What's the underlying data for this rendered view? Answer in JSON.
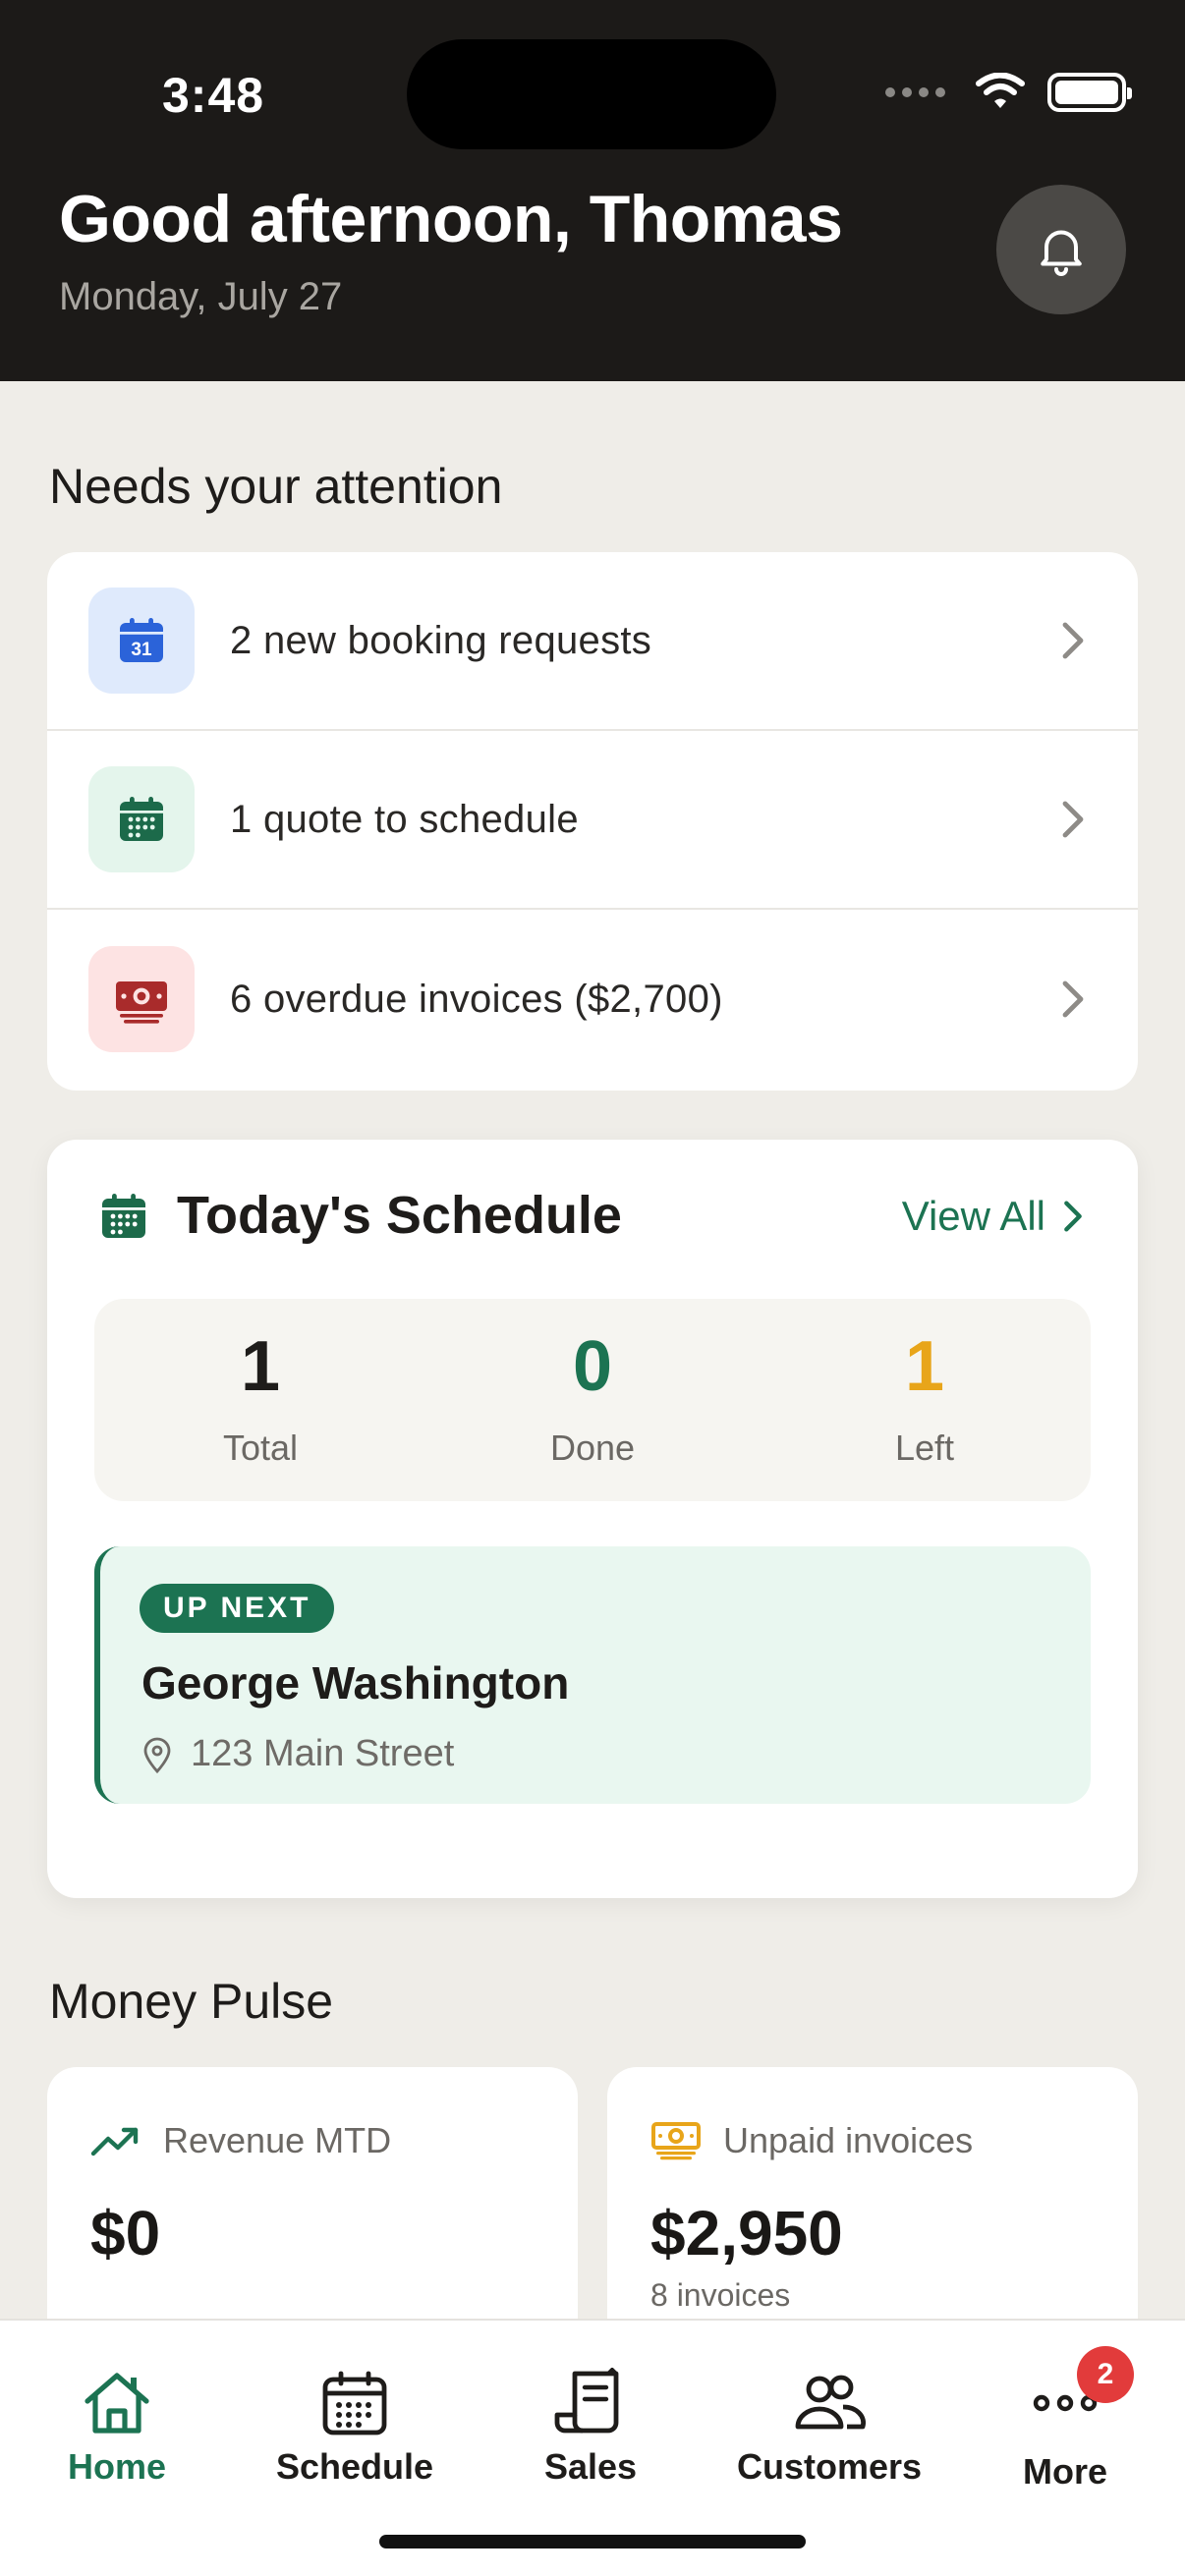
{
  "status_bar": {
    "time": "3:48"
  },
  "header": {
    "greeting": "Good afternoon, Thomas",
    "date": "Monday, July 27",
    "bell_icon": "bell-icon"
  },
  "attention": {
    "title": "Needs your attention",
    "items": [
      {
        "label": "2 new booking requests",
        "icon": "calendar-31-icon",
        "icon_bg": "#dfeafc",
        "icon_color": "#2b63d9"
      },
      {
        "label": "1 quote to schedule",
        "icon": "calendar-grid-icon",
        "icon_bg": "#e4f5ec",
        "icon_color": "#1c6a4a"
      },
      {
        "label": "6 overdue invoices ($2,700)",
        "icon": "cash-icon",
        "icon_bg": "#fde3e3",
        "icon_color": "#a92b2b"
      }
    ]
  },
  "schedule": {
    "title": "Today's Schedule",
    "view_all": "View All",
    "stats": [
      {
        "value": "1",
        "label": "Total",
        "color": "#1e1c1a"
      },
      {
        "value": "0",
        "label": "Done",
        "color": "#1c7352"
      },
      {
        "value": "1",
        "label": "Left",
        "color": "#e8a51a"
      }
    ],
    "up_next": {
      "badge": "UP NEXT",
      "name": "George Washington",
      "address": "123 Main Street"
    }
  },
  "money": {
    "title": "Money Pulse",
    "cards": [
      {
        "label": "Revenue MTD",
        "value": "$0",
        "sub": "",
        "icon": "trend-up-icon"
      },
      {
        "label": "Unpaid invoices",
        "value": "$2,950",
        "sub": "8 invoices",
        "icon": "cash-icon"
      }
    ]
  },
  "tabs": [
    {
      "label": "Home",
      "icon": "home-icon",
      "active": true
    },
    {
      "label": "Schedule",
      "icon": "calendar-icon",
      "active": false
    },
    {
      "label": "Sales",
      "icon": "receipt-icon",
      "active": false
    },
    {
      "label": "Customers",
      "icon": "people-icon",
      "active": false
    },
    {
      "label": "More",
      "icon": "more-icon",
      "active": false,
      "badge": "2"
    }
  ],
  "colors": {
    "brand": "#1c7352",
    "header_bg": "#1c1a18",
    "page_bg": "#efede8"
  }
}
